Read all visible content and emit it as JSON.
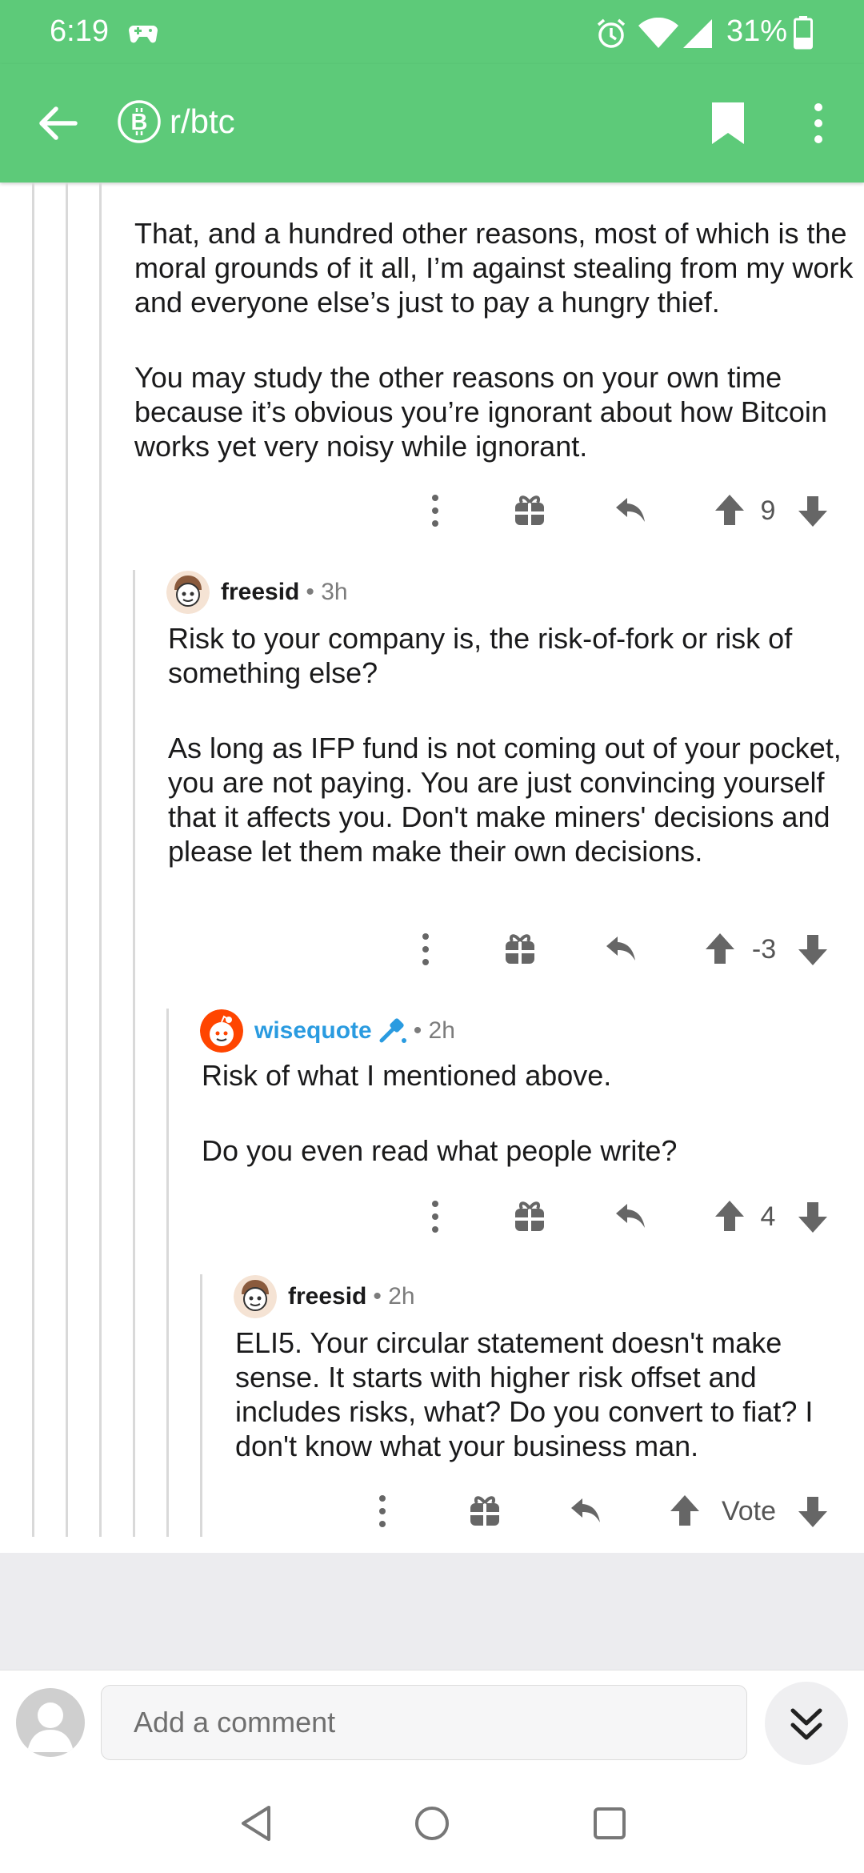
{
  "status_bar": {
    "time": "6:19",
    "battery": "31%",
    "icons": [
      "game-controller-icon",
      "alarm-icon",
      "wifi-icon",
      "signal-icon",
      "battery-icon"
    ]
  },
  "app_bar": {
    "subreddit": "r/btc",
    "icons": [
      "back-arrow-icon",
      "bitcoin-icon",
      "bookmark-icon",
      "more-vert-icon"
    ]
  },
  "comments": [
    {
      "paragraphs": [
        "That, and a hundred other reasons, most of which is the moral grounds of it all, I’m against stealing from my work and everyone else’s just to pay a hungry thief.",
        "You may study the other reasons on your own time because it’s obvious you’re ignorant about how Bitcoin works yet very noisy while ignorant."
      ],
      "score": "9"
    },
    {
      "author": "freesid",
      "time": "• 3h",
      "paragraphs": [
        "Risk to your company is, the risk-of-fork or risk of something else?",
        "As long as IFP fund is not coming out of your pocket, you are not paying. You are just convincing yourself that it affects you. Don't make miners' decisions and please let them make their own decisions."
      ],
      "score": "-3"
    },
    {
      "author": "wisequote",
      "time": "• 2h",
      "moderator": true,
      "paragraphs": [
        "Risk of what I mentioned above.",
        "Do you even read what people write?"
      ],
      "score": "4"
    },
    {
      "author": "freesid",
      "time": "• 2h",
      "paragraphs": [
        "ELI5. Your circular statement doesn't make sense. It starts with higher risk offset and includes risks, what? Do you convert to fiat? I don't know what your business man."
      ],
      "score": "Vote"
    }
  ],
  "comment_bar": {
    "placeholder": "Add a comment"
  },
  "colors": {
    "header_green": "#5dca79",
    "moderator_blue": "#2a9be0",
    "thread_line": "#d9d9d9"
  }
}
